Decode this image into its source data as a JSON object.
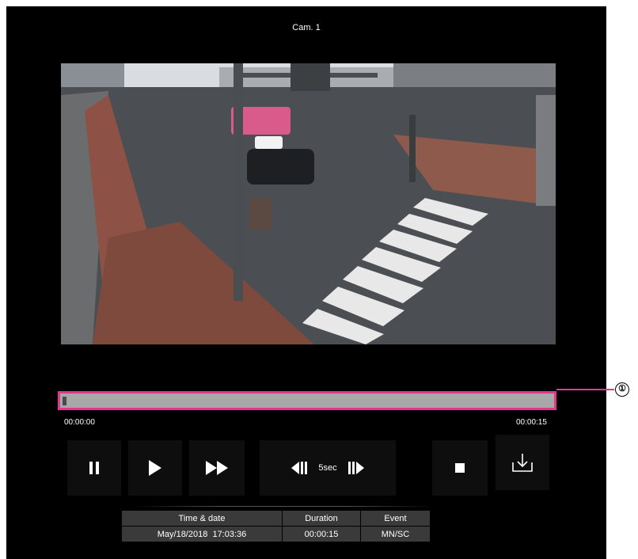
{
  "camera": {
    "title": "Cam. 1"
  },
  "seekbar": {
    "start_time": "00:00:00",
    "end_time": "00:00:15",
    "progress": 0.0,
    "accent_color": "#e2378d"
  },
  "callout": {
    "number": "①"
  },
  "controls": {
    "pause_icon": "pause-icon",
    "play_icon": "play-icon",
    "fast_forward_icon": "fast-forward-icon",
    "skip_back_icon": "skip-back-icon",
    "skip_label": "5sec",
    "skip_forward_icon": "skip-forward-icon",
    "stop_icon": "stop-icon",
    "download_icon": "download-icon"
  },
  "info_table": {
    "headers": [
      "Time & date",
      "Duration",
      "Event"
    ],
    "row": [
      "May/18/2018  17:03:36",
      "00:00:15",
      "MN/SC"
    ]
  }
}
